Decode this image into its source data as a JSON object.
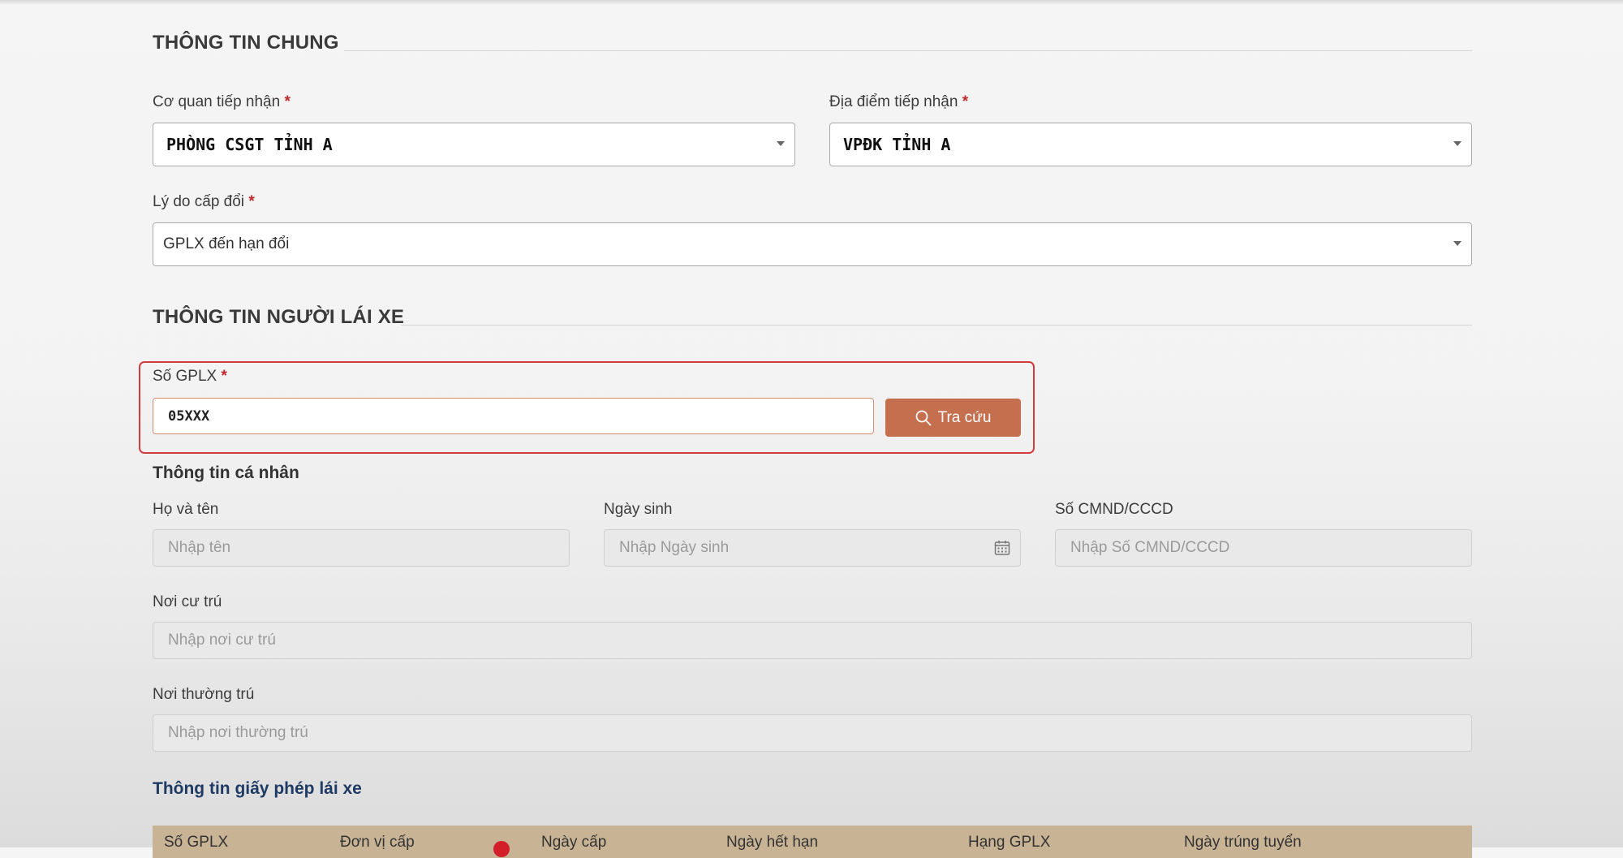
{
  "section_general": {
    "title": "THÔNG TIN CHUNG",
    "receiving_agency": {
      "label": "Cơ quan tiếp nhận",
      "required": "*",
      "value": "PHÒNG CSGT TỈNH A"
    },
    "receiving_location": {
      "label": "Địa điểm tiếp nhận",
      "required": "*",
      "value": "VPĐK TỈNH A"
    },
    "reason": {
      "label": "Lý do cấp đổi",
      "required": "*",
      "value": "GPLX đến hạn đổi"
    }
  },
  "section_driver": {
    "title": "THÔNG TIN NGƯỜI LÁI XE",
    "license_number": {
      "label": "Số GPLX",
      "required": "*",
      "value": "05XXX"
    },
    "search_button": "Tra cứu",
    "personal_info_title": "Thông tin cá nhân",
    "full_name": {
      "label": "Họ và tên",
      "placeholder": "Nhập tên"
    },
    "birth_date": {
      "label": "Ngày sinh",
      "placeholder": "Nhập Ngày sinh"
    },
    "id_number": {
      "label": "Số CMND/CCCD",
      "placeholder": "Nhập Số CMND/CCCD"
    },
    "residence": {
      "label": "Nơi cư trú",
      "placeholder": "Nhập nơi cư trú"
    },
    "permanent_residence": {
      "label": "Nơi thường trú",
      "placeholder": "Nhập nơi thường trú"
    }
  },
  "license_info": {
    "title": "Thông tin giấy phép lái xe",
    "columns": [
      "Số GPLX",
      "Đơn vị cấp",
      "Ngày cấp",
      "Ngày hết hạn",
      "Hạng GPLX",
      "Ngày trúng tuyển"
    ]
  },
  "colors": {
    "accent_button": "#c56f4f",
    "highlight_border": "#d23b40",
    "required_mark": "#c0282d",
    "table_header": "#c8b394",
    "blue_title": "#1f3a63"
  },
  "icons": [
    "search-icon",
    "calendar-icon",
    "chevron-down-icon"
  ]
}
